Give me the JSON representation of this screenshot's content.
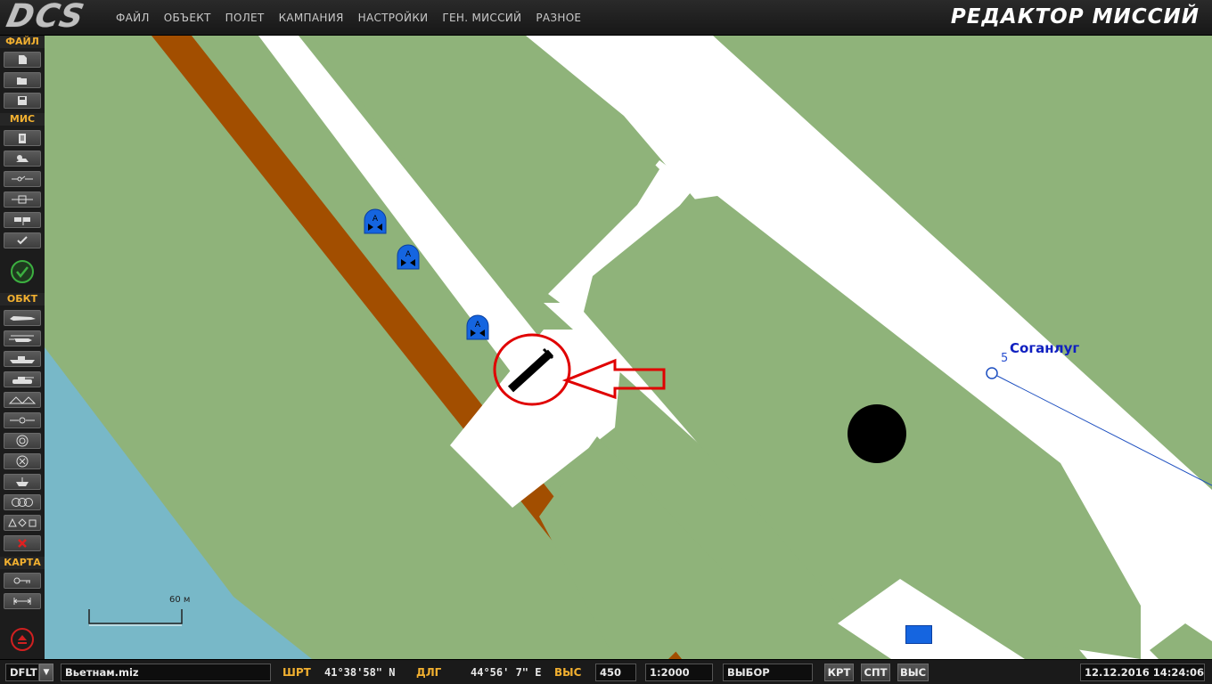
{
  "app": {
    "logo_text": "DCS",
    "title": "РЕДАКТОР МИССИЙ"
  },
  "menu": [
    "ФАЙЛ",
    "ОБЪЕКТ",
    "ПОЛЕТ",
    "КАМПАНИЯ",
    "НАСТРОЙКИ",
    "ГЕН. МИССИЙ",
    "РАЗНОЕ"
  ],
  "toolbar": {
    "sections": {
      "file": "ФАЙЛ",
      "mission": "МИС",
      "objects": "ОБКТ",
      "map": "КАРТА"
    },
    "file_buttons": [
      "new-file-icon",
      "open-file-icon",
      "save-file-icon"
    ],
    "mission_buttons": [
      "briefing-icon",
      "weather-icon",
      "trigger-icon",
      "zone-icon",
      "goals-icon",
      "check-icon"
    ],
    "object_buttons": [
      "aircraft-icon",
      "helicopter-icon",
      "ship-icon",
      "ground-vehicle-icon",
      "static-object-icon",
      "navpoint-icon",
      "target-zone-icon",
      "initial-point-icon",
      "airdrome-icon",
      "template-icon",
      "shapes-icon",
      "delete-icon"
    ],
    "map_buttons": [
      "ruler-icon",
      "measure-icon"
    ]
  },
  "map": {
    "waypoint_label": "Соганлуг",
    "waypoint_number": "5",
    "scale_label": "60 м",
    "colors": {
      "grass": "#8fb37a",
      "road": "#ffffff",
      "river_bank": "#a24e00",
      "water": "#78b8c8",
      "unit": "#1565e0",
      "annotation": "#e00000"
    },
    "units": [
      {
        "name": "unit-a",
        "label": "A"
      },
      {
        "name": "unit-b",
        "label": "A"
      },
      {
        "name": "unit-c",
        "label": "A"
      }
    ]
  },
  "status": {
    "coalition": "DFLT",
    "filename": "Вьетнам.miz",
    "lat_label": "ШРТ",
    "lat_value": "41°38'58\" N",
    "lon_label": "ДЛГ",
    "lon_value": "44°56' 7\" E",
    "alt_label": "ВЫС",
    "alt_value": "450",
    "scale": "1:2000",
    "mode": "ВЫБОР",
    "btn_map": "КРТ",
    "btn_sat": "СПТ",
    "btn_alt": "ВЫС",
    "datetime": "12.12.2016 14:24:06"
  }
}
